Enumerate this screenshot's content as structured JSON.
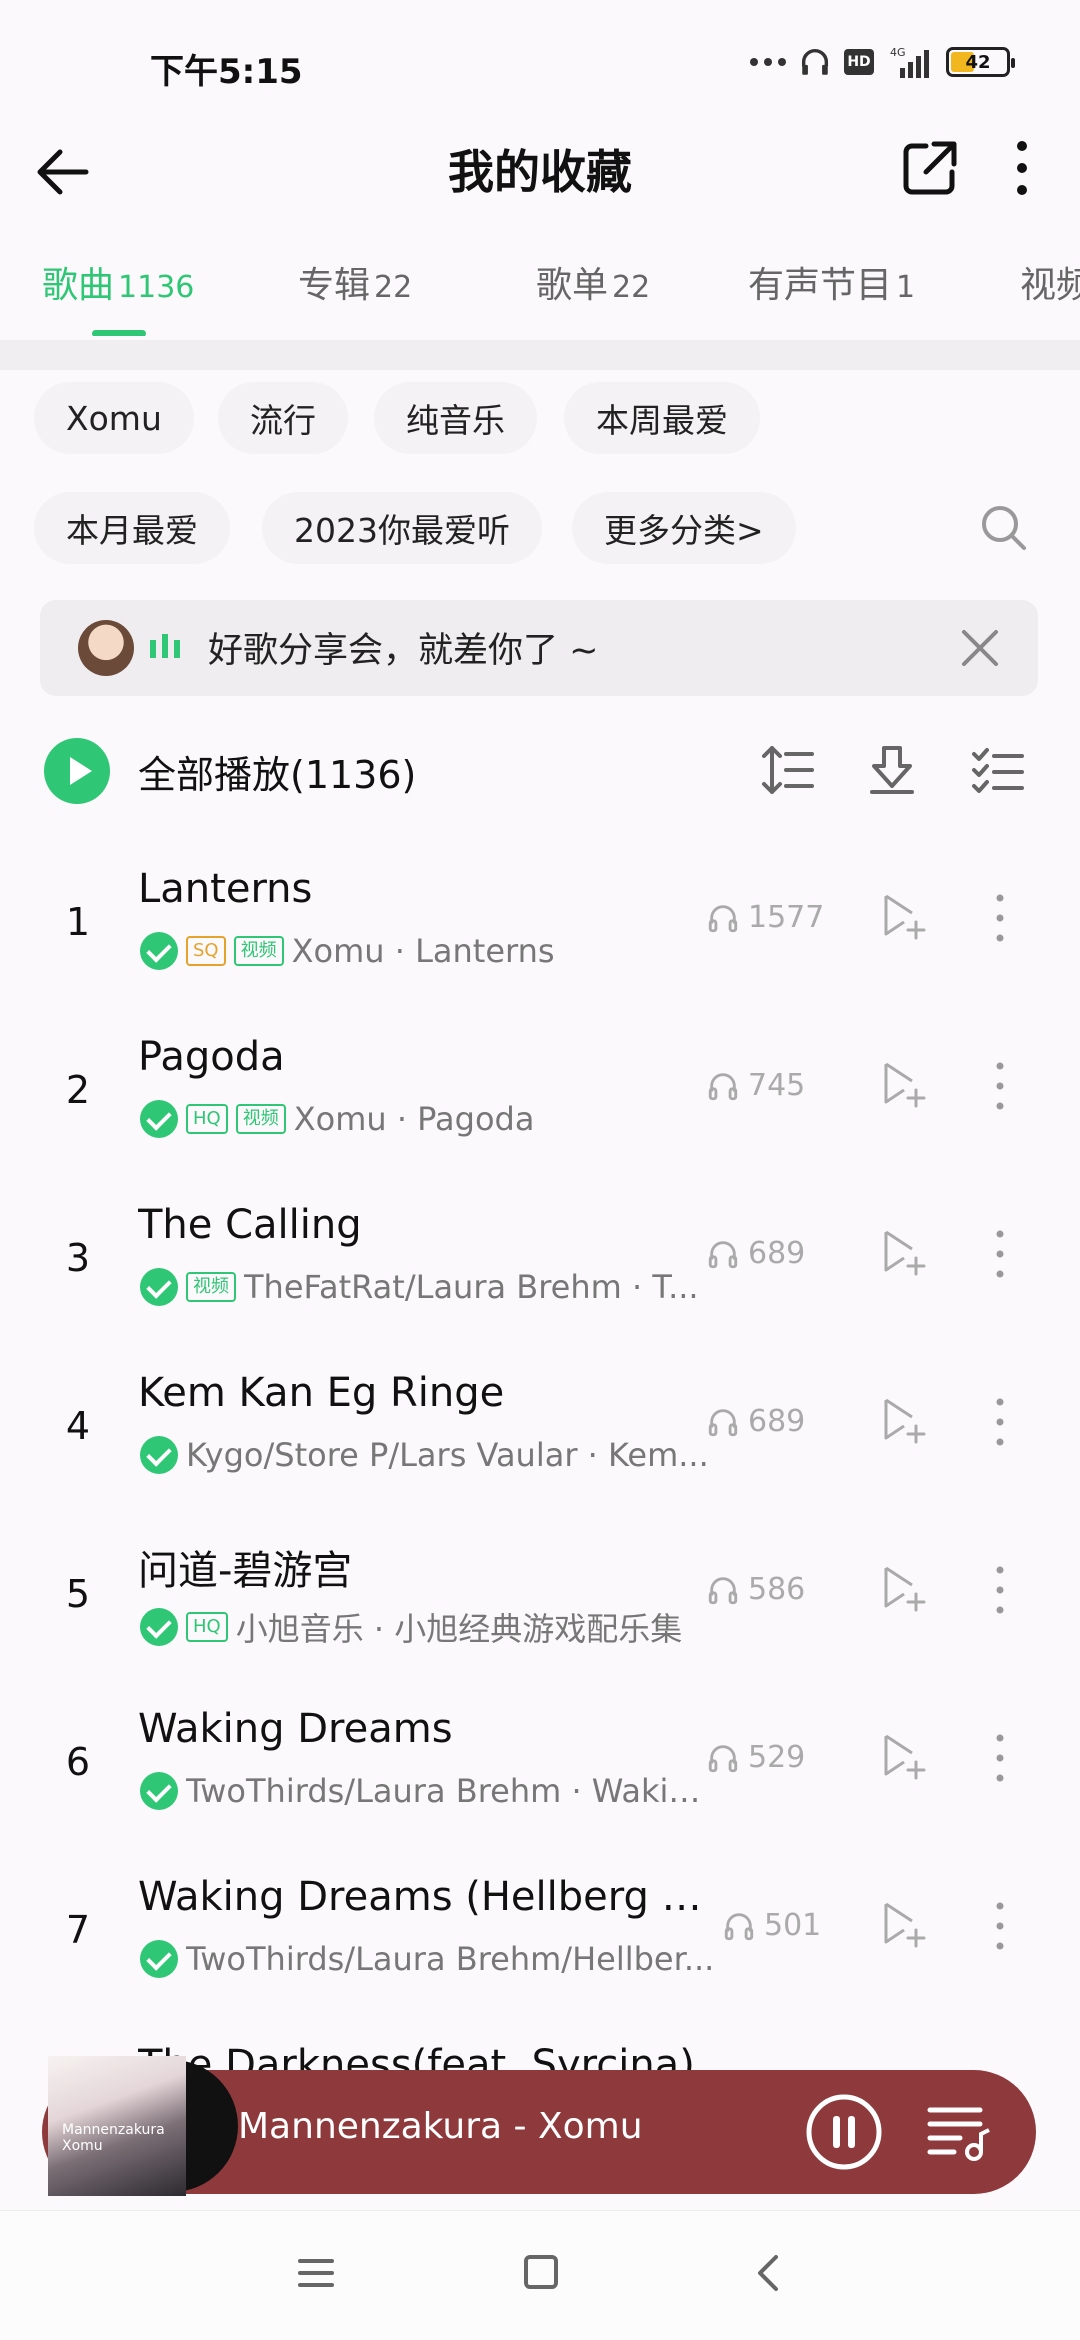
{
  "status": {
    "time": "下午5:15",
    "signal_label": "4G",
    "battery": "42"
  },
  "header": {
    "title": "我的收藏",
    "back_icon": "arrow-left-icon",
    "share_icon": "external-share-icon",
    "more_icon": "more-vertical-icon"
  },
  "tabs": [
    {
      "label": "歌曲",
      "count": "1136",
      "active": true
    },
    {
      "label": "专辑",
      "count": "22"
    },
    {
      "label": "歌单",
      "count": "22"
    },
    {
      "label": "有声节目",
      "count": "1"
    },
    {
      "label": "视频",
      "count": ""
    }
  ],
  "chips": [
    "Xomu",
    "流行",
    "纯音乐",
    "本周最爱",
    "本月最爱",
    "2023你最爱听",
    "更多分类>"
  ],
  "banner": {
    "text": "好歌分享会，就差你了 ~"
  },
  "play_all": {
    "label": "全部播放(1136)"
  },
  "songs": [
    {
      "index": "1",
      "title": "Lanterns",
      "tags": [
        "SQ",
        "视频"
      ],
      "artist": "Xomu · Lanterns",
      "plays": "1577"
    },
    {
      "index": "2",
      "title": "Pagoda",
      "tags": [
        "HQ",
        "视频"
      ],
      "artist": "Xomu · Pagoda",
      "plays": "745"
    },
    {
      "index": "3",
      "title": "The Calling",
      "tags": [
        "视频"
      ],
      "artist": "TheFatRat/Laura Brehm · T...",
      "plays": "689"
    },
    {
      "index": "4",
      "title": "Kem Kan Eg Ringe",
      "tags": [],
      "artist": "Kygo/Store P/Lars Vaular · Kem...",
      "plays": "689"
    },
    {
      "index": "5",
      "title": "问道-碧游宫",
      "tags": [
        "HQ"
      ],
      "artist": "小旭音乐 · 小旭经典游戏配乐集",
      "plays": "586"
    },
    {
      "index": "6",
      "title": "Waking Dreams",
      "tags": [],
      "artist": "TwoThirds/Laura Brehm · Wakin...",
      "plays": "529"
    },
    {
      "index": "7",
      "title": "Waking Dreams (Hellberg R...",
      "tags": [],
      "artist": "TwoThirds/Laura Brehm/Hellber...",
      "plays": "501"
    },
    {
      "index": "8",
      "title": "The Darkness(feat. Syrcina)",
      "tags": [],
      "artist": "",
      "plays": ""
    }
  ],
  "player": {
    "track": "Mannenzakura - Xomu",
    "cover_text": "Mannenzakura Xomu"
  },
  "colors": {
    "accent": "#2fc775",
    "player_bg": "#8e3a3d",
    "sq_tag": "#e5a32c"
  }
}
